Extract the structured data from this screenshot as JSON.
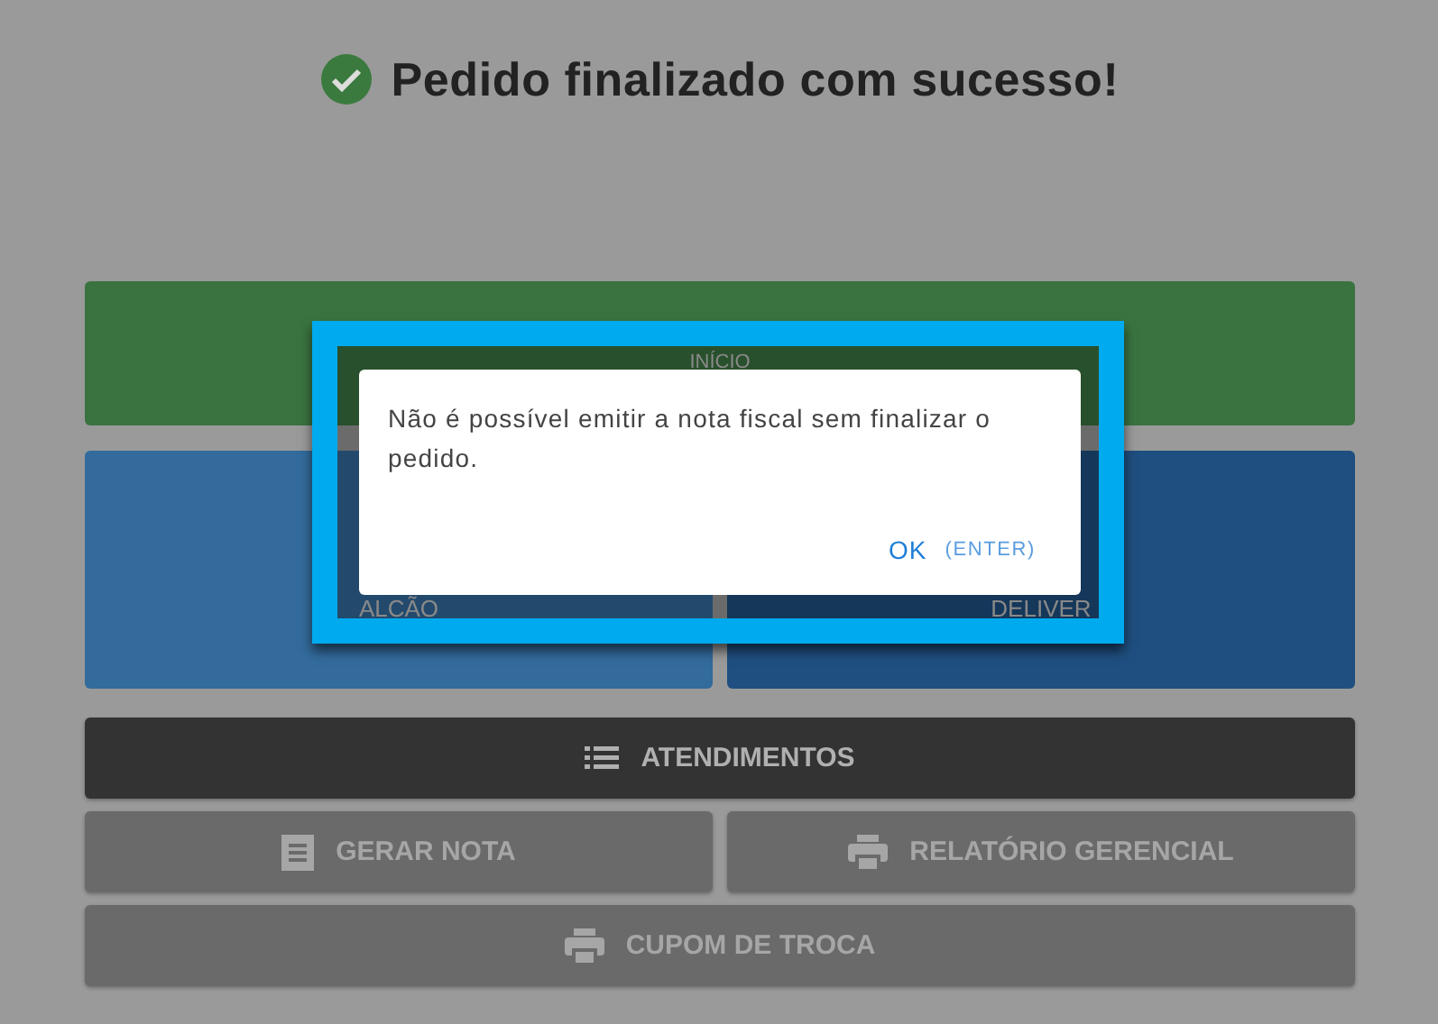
{
  "title": "Pedido finalizado com sucesso!",
  "tiles": [
    {
      "label": "INÍCIO",
      "kind": "wide",
      "color": "#3a7340"
    },
    {
      "label": "ALCÃO",
      "kind": "half",
      "color": "#336b9c"
    },
    {
      "label": "DELIVER",
      "kind": "half",
      "color": "#1f4f80"
    }
  ],
  "actions": [
    {
      "label": "ATENDIMENTOS",
      "disabled": false,
      "kind": "list"
    },
    {
      "label": "GERAR NOTA",
      "disabled": true,
      "kind": "document"
    },
    {
      "label": "RELATÓRIO GERENCIAL",
      "disabled": true,
      "kind": "printer"
    },
    {
      "label": "CUPOM DE TROCA",
      "disabled": true,
      "kind": "printer"
    }
  ],
  "dialog": {
    "message": "Não é possível emitir a nota fiscal sem finalizar o pedido.",
    "ok_label": "OK",
    "shortcut_hint": "(ENTER)"
  }
}
